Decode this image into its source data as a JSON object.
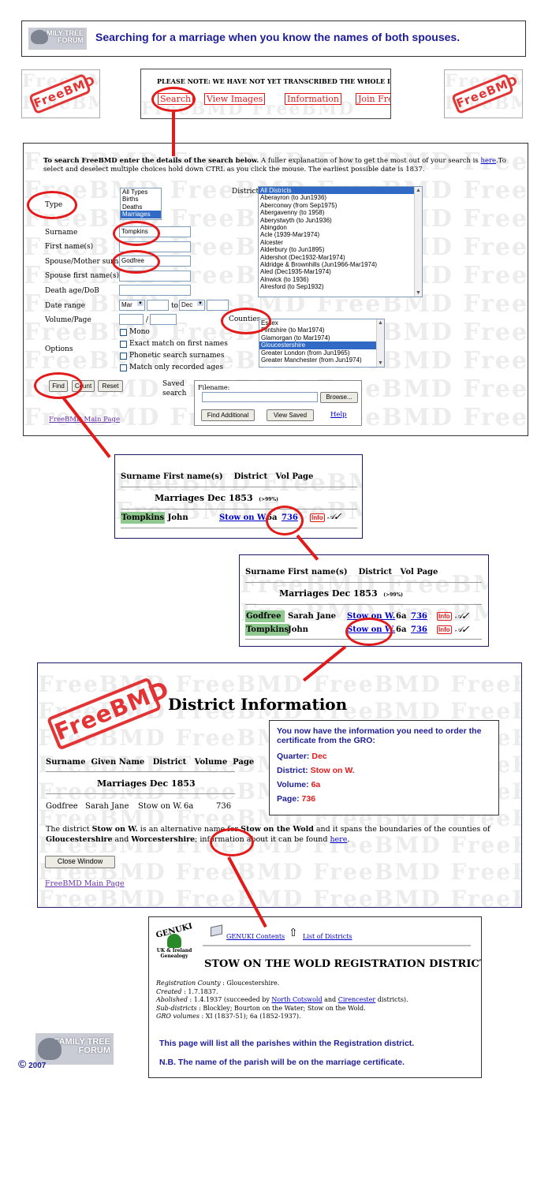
{
  "header": {
    "logo_text": "FAMILY TREE FORUM",
    "title": "Searching for a marriage when you know the names of both spouses."
  },
  "topbar": {
    "notice": "PLEASE NOTE: WE HAVE NOT YET TRANSCRIBED THE WHOLE INDEX. A",
    "tabs": [
      "Search",
      "View Images",
      "Information",
      "Join Fre"
    ],
    "stamp": "FreeBMD"
  },
  "search": {
    "intro_bold": "To search FreeBMD enter the details of the search below.",
    "intro_rest": " A fuller explanation of how to get the most out of your search is ",
    "intro_link": "here",
    "intro_end": ".To select and deselect multiple choices hold down CTRL as you click the mouse. The earliest possible date is 1837.",
    "type_label": "Type",
    "types": [
      "All Types",
      "Births",
      "Deaths",
      "Marriages"
    ],
    "districts_label": "Districts",
    "districts": [
      "All Districts",
      "Aberayron (to Jun1936)",
      "Aberconwy (from Sep1975)",
      "Abergavenny (to 1958)",
      "Aberystwyth (to Jun1936)",
      "Abingdon",
      "Acle (1939-Mar1974)",
      "Alcester",
      "Alderbury (to Jun1895)",
      "Aldershot (Dec1932-Mar1974)",
      "Aldridge & Brownhills (Jun1966-Mar1974)",
      "Aled (Dec1935-Mar1974)",
      "Alnwick (to 1936)",
      "Alresford (to Sep1932)"
    ],
    "surname_label": "Surname",
    "surname_value": "Tompkins",
    "firstname_label": "First name(s)",
    "spouse_label": "Spouse/Mother surname",
    "spouse_value": "Godfree",
    "spouse_first_label": "Spouse first name(s)",
    "death_label": "Death age/DoB",
    "date_label": "Date range",
    "date_from": "Mar",
    "date_to_word": "to",
    "date_to": "Dec",
    "volume_label": "Volume/Page",
    "slash": "/",
    "counties_label": "Counties",
    "counties": [
      "Essex",
      "Flintshire (to Mar1974)",
      "Glamorgan (to Mar1974)",
      "Gloucestershire",
      "Greater London (from Jun1965)",
      "Greater Manchester (from Jun1974)"
    ],
    "options_label": "Options",
    "options": [
      "Mono",
      "Exact match on first names",
      "Phonetic search surnames",
      "Match only recorded ages"
    ],
    "find": "Find",
    "count": "Count",
    "reset": "Reset",
    "saved_label1": "Saved",
    "saved_label2": "search",
    "filename_label": "Filename:",
    "browse": "Browse...",
    "find_additional": "Find Additional",
    "view_saved": "View Saved",
    "help": "Help",
    "main_page": "FreeBMD Main Page"
  },
  "results1": {
    "headers": [
      "Surname",
      "First name(s)",
      "District",
      "Vol",
      "Page"
    ],
    "section": "Marriages Dec 1853",
    "accuracy": "(>99%)",
    "row": {
      "surname": "Tompkins",
      "first": "John",
      "district": "Stow on W.",
      "vol": "6a",
      "page": "736"
    },
    "info": "Info"
  },
  "results2": {
    "headers": [
      "Surname",
      "First name(s)",
      "District",
      "Vol",
      "Page"
    ],
    "section": "Marriages Dec 1853",
    "accuracy": "(>99%)",
    "rows": [
      {
        "surname": "Godfree",
        "first": "Sarah Jane",
        "district": "Stow on W.",
        "vol": "6a",
        "page": "736"
      },
      {
        "surname": "Tompkins",
        "first": "John",
        "district": "Stow on W.",
        "vol": "6a",
        "page": "736"
      }
    ],
    "info": "Info"
  },
  "district": {
    "stamp": "FreeBMD",
    "title": "District Information",
    "headers": [
      "Surname",
      "Given Name",
      "District",
      "Volume",
      "Page"
    ],
    "section": "Marriages Dec 1853",
    "row": {
      "surname": "Godfree",
      "given": "Sarah Jane",
      "district": "Stow on W.",
      "volume": "6a",
      "page": "736"
    },
    "note_a": "The district ",
    "note_b": "Stow on W.",
    "note_c": " is an alternative name for ",
    "note_d": "Stow on the Wold",
    "note_e": " and it spans the boundaries of the counties of ",
    "note_f": "Gloucestershire",
    "note_g": " and ",
    "note_h": "Worcestershire",
    "note_i": "; information about it can be found ",
    "note_link": "here",
    "note_j": ".",
    "close": "Close Window",
    "main_page": "FreeBMD Main Page",
    "callout": {
      "intro": "You now have the information you need to order the certificate from the GRO:",
      "quarter_label": "Quarter:",
      "quarter": "Dec",
      "district_label": "District:",
      "district": "Stow on W.",
      "volume_label": "Volume:",
      "volume": "6a",
      "page_label": "Page:",
      "page": "736"
    }
  },
  "genuki": {
    "logo": "GENUKI",
    "logo_sub1": "UK & Ireland",
    "logo_sub2": "Genealogy",
    "contents": "GENUKI Contents",
    "list": "List of Districts",
    "title": "STOW ON THE WOLD REGISTRATION DISTRICT",
    "county_label": "Registration County",
    "county": " : Gloucestershire.",
    "created_label": "Created",
    "created": " : 1.7.1837.",
    "abolished_label": "Abolished",
    "abolished_a": " : 1.4.1937 (succeeded by ",
    "abolished_l1": "North Cotswold",
    "abolished_b": " and ",
    "abolished_l2": "Cirencester",
    "abolished_c": " districts).",
    "subs_label": "Sub-districts",
    "subs": " : Blockley; Bourton on the Water; Stow on the Wold.",
    "gro_label": "GRO volumes",
    "gro": " : XI (1837-51); 6a (1852-1937).",
    "note1": "This page will list all the parishes within the Registration district.",
    "note2": "N.B. The name of the parish will be on the marriage certificate."
  },
  "footer": {
    "logo_text": "FAMILY TREE FORUM",
    "copyright": "©",
    "year": "2007"
  },
  "colors": {
    "accent_red": "#e31a1a",
    "title_blue": "#1d1d99",
    "highlight_green": "#8fc98f"
  }
}
